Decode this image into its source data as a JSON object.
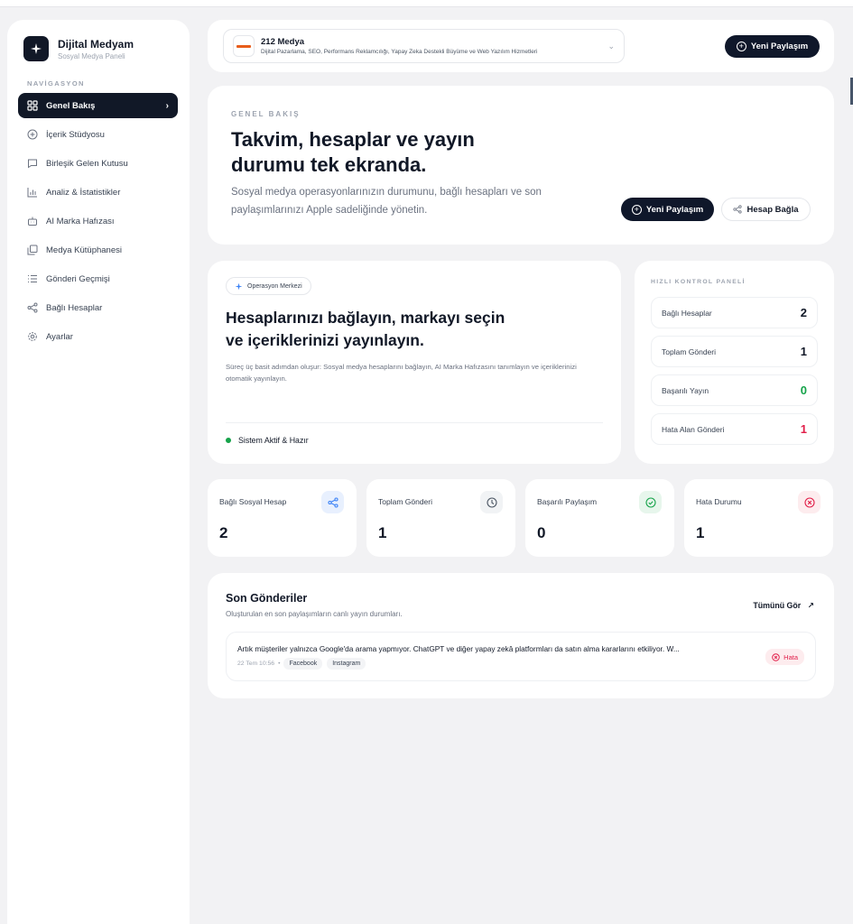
{
  "sidebar": {
    "brand_title": "Dijital Medyam",
    "brand_subtitle": "Sosyal Medya Paneli",
    "nav_heading": "NAVİGASYON",
    "items": [
      {
        "label": "Genel Bakış",
        "icon": "grid-icon",
        "active": true
      },
      {
        "label": "İçerik Stüdyosu",
        "icon": "plus-circle-icon"
      },
      {
        "label": "Birleşik Gelen Kutusu",
        "icon": "message-icon"
      },
      {
        "label": "Analiz & İstatistikler",
        "icon": "bar-chart-icon"
      },
      {
        "label": "AI Marka Hafızası",
        "icon": "bot-icon"
      },
      {
        "label": "Medya Kütüphanesi",
        "icon": "gallery-icon"
      },
      {
        "label": "Gönderi Geçmişi",
        "icon": "list-icon"
      },
      {
        "label": "Bağlı Hesaplar",
        "icon": "share-icon"
      },
      {
        "label": "Ayarlar",
        "icon": "gear-icon"
      }
    ]
  },
  "workspace": {
    "name": "212 Medya",
    "description": "Dijital Pazarlama, SEO, Performans Reklamcılığı, Yapay Zeka Destekli Büyüme ve Web Yazılım Hizmetleri"
  },
  "header": {
    "new_post_label": "Yeni Paylaşım"
  },
  "hero": {
    "eyebrow": "GENEL BAKIŞ",
    "title": "Takvim, hesaplar ve yayın durumu tek ekranda.",
    "description": "Sosyal medya operasyonlarınızın durumunu, bağlı hesapları ve son paylaşımlarınızı Apple sadeliğinde yönetin.",
    "new_post_label": "Yeni Paylaşım",
    "connect_label": "Hesap Bağla"
  },
  "operations": {
    "pill": "Operasyon Merkezi",
    "title": "Hesaplarınızı bağlayın, markayı seçin ve içeriklerinizi yayınlayın.",
    "description": "Süreç üç basit adımdan oluşur: Sosyal medya hesaplarını bağlayın, AI Marka Hafızasını tanımlayın ve içeriklerinizi otomatik yayınlayın.",
    "status": "Sistem Aktif & Hazır"
  },
  "quick_panel": {
    "heading": "HIZLI KONTROL PANELİ",
    "rows": [
      {
        "label": "Bağlı Hesaplar",
        "value": "2",
        "color": "#111827"
      },
      {
        "label": "Toplam Gönderi",
        "value": "1",
        "color": "#111827"
      },
      {
        "label": "Başarılı Yayın",
        "value": "0",
        "color": "#16a34a"
      },
      {
        "label": "Hata Alan Gönderi",
        "value": "1",
        "color": "#e11d48"
      }
    ]
  },
  "stats": [
    {
      "label": "Bağlı Sosyal Hesap",
      "value": "2",
      "icon": "share-icon",
      "accent": "#3b82f6"
    },
    {
      "label": "Toplam Gönderi",
      "value": "1",
      "icon": "clock-icon",
      "accent": "#4b5563"
    },
    {
      "label": "Başarılı Paylaşım",
      "value": "0",
      "icon": "check-circle-icon",
      "accent": "#16a34a"
    },
    {
      "label": "Hata Durumu",
      "value": "1",
      "icon": "x-circle-icon",
      "accent": "#e11d48"
    }
  ],
  "recent": {
    "title": "Son Gönderiler",
    "subtitle": "Oluşturulan en son paylaşımların canlı yayın durumları.",
    "view_all": "Tümünü Gör",
    "items": [
      {
        "text": "Artık müşteriler yalnızca Google'da arama yapmıyor. ChatGPT ve diğer yapay zekâ platformları da satın alma kararlarını etkiliyor. W...",
        "date": "22 Tem 10:56",
        "platforms": [
          "Facebook",
          "Instagram"
        ],
        "status": "Hata"
      }
    ]
  }
}
